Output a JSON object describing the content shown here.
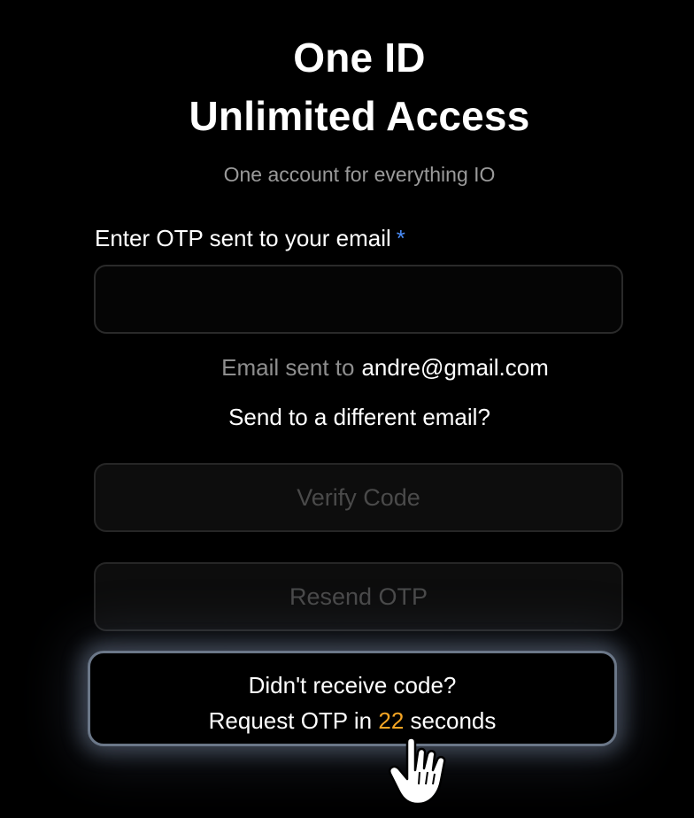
{
  "header": {
    "title_line1": "One ID",
    "title_line2": "Unlimited Access",
    "subtitle": "One account for everything IO"
  },
  "otp_field": {
    "label": "Enter OTP sent to your email",
    "required_mark": "*",
    "value": "",
    "placeholder": ""
  },
  "email_info": {
    "prefix": "Email sent to",
    "address": "andre@gmail.com"
  },
  "change_email_link": "Send to a different email?",
  "buttons": {
    "verify": "Verify Code",
    "resend": "Resend OTP"
  },
  "tooltip": {
    "line1": "Didn't receive code?",
    "line2_prefix": "Request OTP in",
    "seconds": "22",
    "line2_suffix": "seconds"
  },
  "colors": {
    "background": "#000000",
    "required_accent": "#4a8cf7",
    "countdown_accent": "#f5a524"
  },
  "icons": {
    "cursor": "hand-pointer-icon"
  }
}
